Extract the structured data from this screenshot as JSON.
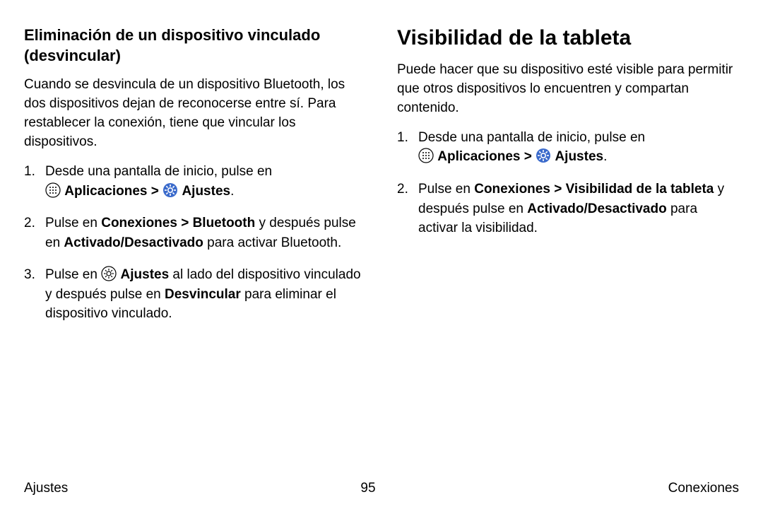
{
  "left": {
    "subheading": "Eliminación de un dispositivo vinculado (desvincular)",
    "intro": "Cuando se desvincula de un dispositivo Bluetooth, los dos dispositivos dejan de reconocerse entre sí. Para restablecer la conexión, tiene que vincular los dispositivos.",
    "step1_a": "Desde una pantalla de inicio, pulse en ",
    "step1_apps": "Aplicaciones",
    "step1_sep": " > ",
    "step1_settings": "Ajustes",
    "step1_end": ".",
    "step2_a": "Pulse en ",
    "step2_bold1": "Conexiones > Bluetooth",
    "step2_b": " y después pulse en ",
    "step2_bold2": "Activado/Desactivado",
    "step2_c": " para activar Bluetooth.",
    "step3_a": "Pulse en ",
    "step3_bold1": "Ajustes",
    "step3_b": " al lado del dispositivo vinculado y después pulse en ",
    "step3_bold2": "Desvincular",
    "step3_c": " para eliminar el dispositivo vinculado."
  },
  "right": {
    "heading": "Visibilidad de la tableta",
    "intro": "Puede hacer que su dispositivo esté visible para permitir que otros dispositivos lo encuentren y compartan contenido.",
    "step1_a": "Desde una pantalla de inicio, pulse en ",
    "step1_apps": "Aplicaciones",
    "step1_sep": " > ",
    "step1_settings": "Ajustes",
    "step1_end": ".",
    "step2_a": "Pulse en ",
    "step2_bold1": "Conexiones > Visibilidad de la tableta",
    "step2_b": " y después pulse en ",
    "step2_bold2": "Activado/Desactivado",
    "step2_c": " para activar la visibilidad."
  },
  "footer": {
    "left": "Ajustes",
    "center": "95",
    "right": "Conexiones"
  }
}
